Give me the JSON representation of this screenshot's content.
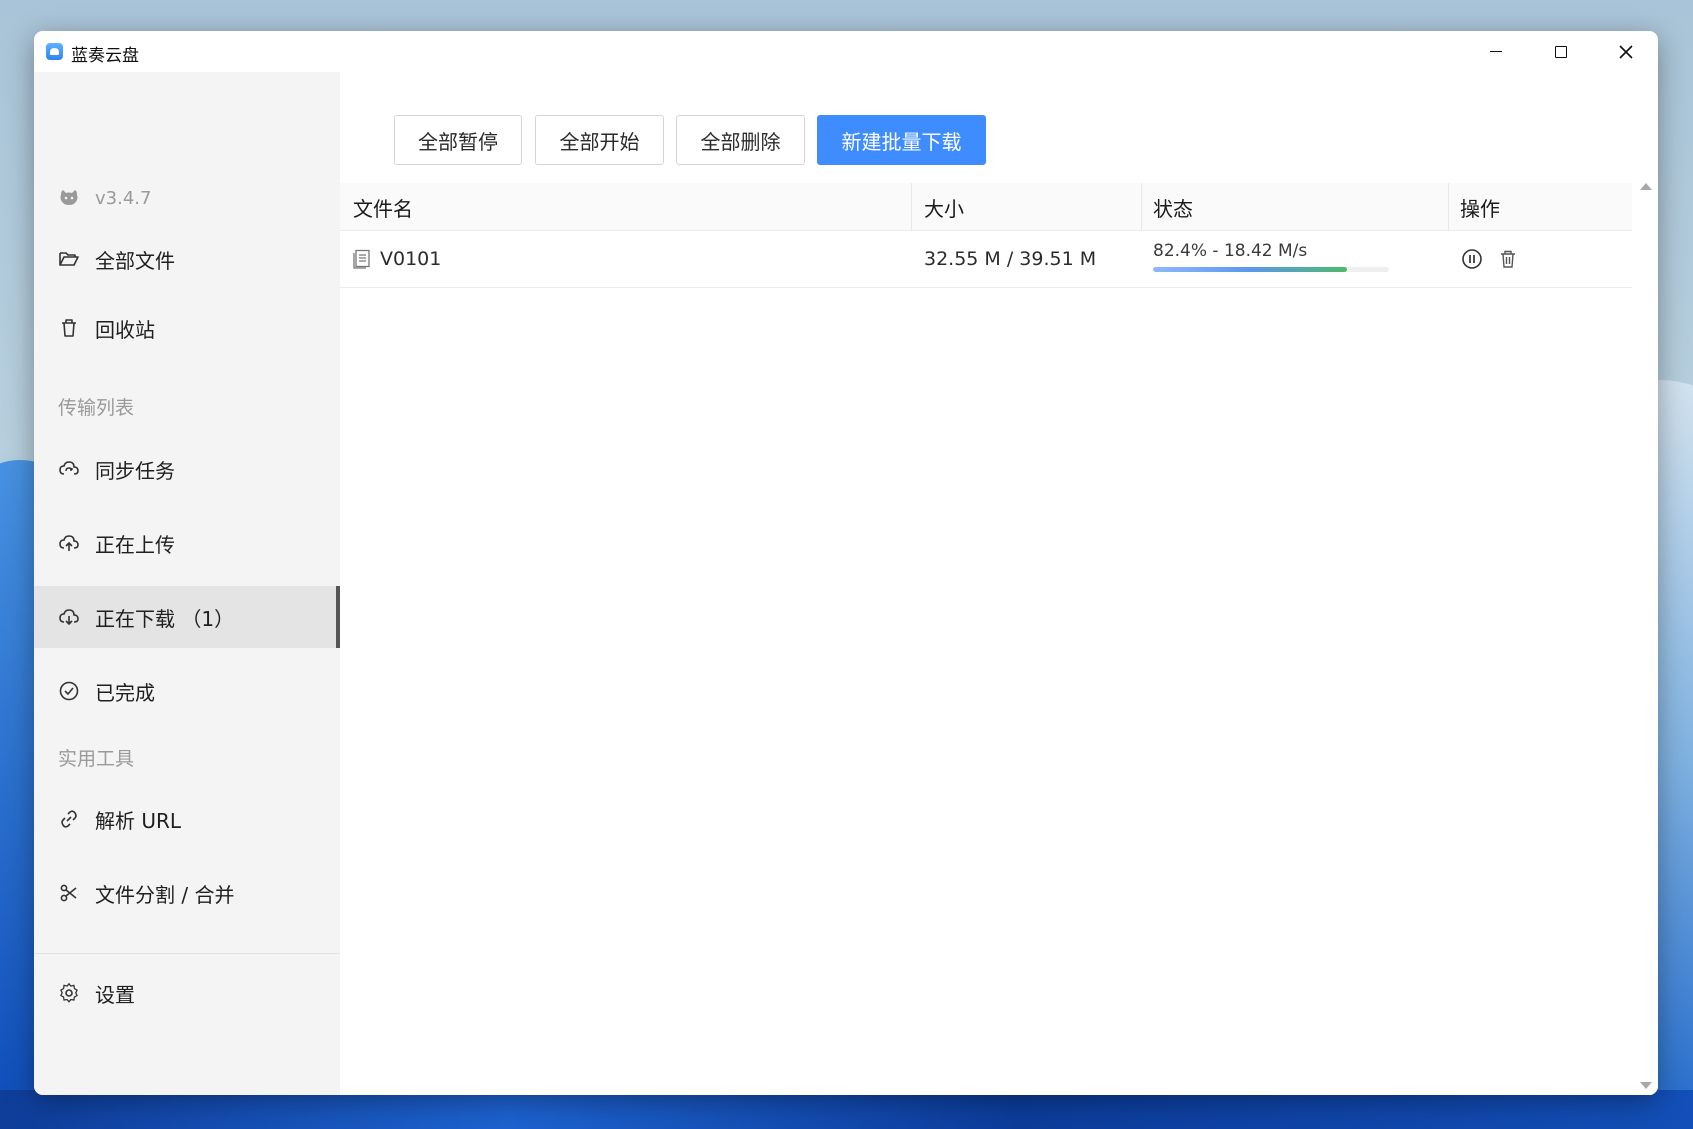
{
  "window": {
    "title": "蓝奏云盘",
    "controls": {
      "minimize": "minimize-icon",
      "maximize": "maximize-icon",
      "close": "close-icon"
    }
  },
  "sidebar": {
    "version": "v3.4.7",
    "items": [
      {
        "id": "all-files",
        "label": "全部文件",
        "icon": "folder-open-icon"
      },
      {
        "id": "recycle",
        "label": "回收站",
        "icon": "trash-icon"
      }
    ],
    "section_transfer": "传输列表",
    "transfer_items": [
      {
        "id": "sync",
        "label": "同步任务",
        "icon": "cloud-sync-icon"
      },
      {
        "id": "uploading",
        "label": "正在上传",
        "icon": "cloud-upload-icon"
      },
      {
        "id": "downloading",
        "label": "正在下载 （1）",
        "icon": "cloud-download-icon",
        "active": true
      },
      {
        "id": "completed",
        "label": "已完成",
        "icon": "check-circle-icon"
      }
    ],
    "section_tools": "实用工具",
    "tool_items": [
      {
        "id": "parse-url",
        "label": "解析 URL",
        "icon": "link-icon"
      },
      {
        "id": "split-merge",
        "label": "文件分割 / 合并",
        "icon": "scissors-icon"
      }
    ],
    "settings": {
      "label": "设置",
      "icon": "gear-icon"
    }
  },
  "toolbar": {
    "pause_all": "全部暂停",
    "start_all": "全部开始",
    "delete_all": "全部删除",
    "new_batch": "新建批量下载",
    "accent": "#3f8cff"
  },
  "table": {
    "headers": [
      "文件名",
      "大小",
      "状态",
      "操作"
    ],
    "rows": [
      {
        "name": "V0101",
        "size": "32.55 M / 39.51 M",
        "status": "82.4% - 18.42 M/s",
        "progress": 0.824,
        "actions": [
          "pause-icon",
          "delete-icon"
        ]
      }
    ]
  }
}
